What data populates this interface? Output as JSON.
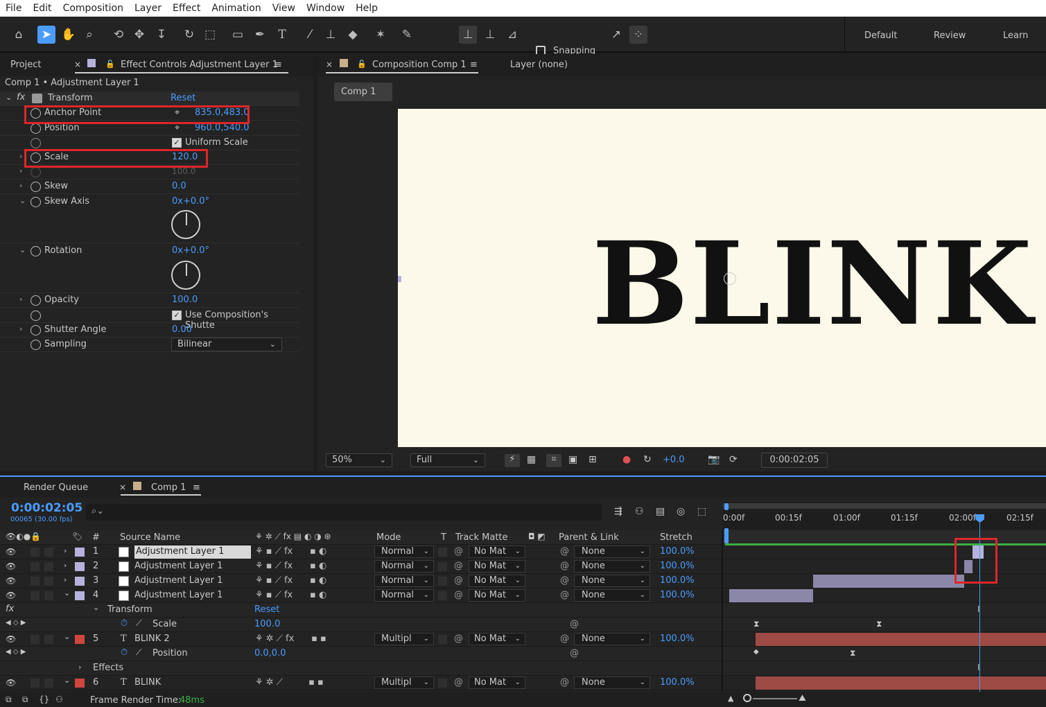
{
  "menu": [
    "File",
    "Edit",
    "Composition",
    "Layer",
    "Effect",
    "Animation",
    "View",
    "Window",
    "Help"
  ],
  "toolbar": {
    "snapping_label": "Snapping",
    "workspaces": [
      "Default",
      "Review",
      "Learn"
    ]
  },
  "project_tab": "Project",
  "effect_controls": {
    "tab_label": "Effect Controls Adjustment Layer 1",
    "breadcrumb": "Comp 1 • Adjustment Layer 1",
    "effect_name": "Transform",
    "reset_label": "Reset",
    "props": {
      "anchor_point": {
        "label": "Anchor Point",
        "value": "835.0,483.0"
      },
      "position": {
        "label": "Position",
        "value": "960.0,540.0"
      },
      "uniform_scale": {
        "label": "Uniform Scale",
        "checked": true
      },
      "scale": {
        "label": "Scale",
        "value": "120.0"
      },
      "scale_height": {
        "value": "100.0"
      },
      "skew": {
        "label": "Skew",
        "value": "0.0"
      },
      "skew_axis": {
        "label": "Skew Axis",
        "value": "0x+0.0°"
      },
      "rotation": {
        "label": "Rotation",
        "value": "0x+0.0°"
      },
      "opacity": {
        "label": "Opacity",
        "value": "100.0"
      },
      "use_comp_shutter": {
        "label": "Use Composition's Shutte",
        "checked": true
      },
      "shutter_angle": {
        "label": "Shutter Angle",
        "value": "0.00"
      },
      "sampling": {
        "label": "Sampling",
        "value": "Bilinear"
      }
    }
  },
  "composition": {
    "tab_label": "Composition Comp 1",
    "layer_tab": "Layer (none)",
    "comp_button": "Comp 1",
    "text": "BLINK",
    "zoom": "50%",
    "resolution": "Full",
    "exposure": "+0.0",
    "timecode": "0:00:02:05"
  },
  "timeline": {
    "render_queue_tab": "Render Queue",
    "comp_tab": "Comp 1",
    "current_time": "0:00:02:05",
    "frame_info": "00065 (30.00 fps)",
    "search_placeholder": "",
    "columns": {
      "num": "#",
      "source_name": "Source Name",
      "mode": "Mode",
      "t": "T",
      "track_matte": "Track Matte",
      "parent_link": "Parent & Link",
      "stretch": "Stretch"
    },
    "ruler": [
      "0:00f",
      "00:15f",
      "01:00f",
      "01:15f",
      "02:00f",
      "02:15f"
    ],
    "layers": [
      {
        "num": "1",
        "name": "Adjustment Layer 1",
        "mode": "Normal",
        "track_matte": "No Mat",
        "parent": "None",
        "stretch": "100.0%",
        "label_color": "#b6b2dc"
      },
      {
        "num": "2",
        "name": "Adjustment Layer 1",
        "mode": "Normal",
        "track_matte": "No Mat",
        "parent": "None",
        "stretch": "100.0%",
        "label_color": "#b6b2dc"
      },
      {
        "num": "3",
        "name": "Adjustment Layer 1",
        "mode": "Normal",
        "track_matte": "No Mat",
        "parent": "None",
        "stretch": "100.0%",
        "label_color": "#b6b2dc"
      },
      {
        "num": "4",
        "name": "Adjustment Layer 1",
        "mode": "Normal",
        "track_matte": "No Mat",
        "parent": "None",
        "stretch": "100.0%",
        "label_color": "#b6b2dc"
      },
      {
        "num": "5",
        "name": "BLINK 2",
        "mode": "Multipl",
        "track_matte": "No Mat",
        "parent": "None",
        "stretch": "100.0%",
        "label_color": "#d0463e"
      },
      {
        "num": "6",
        "name": "BLINK",
        "mode": "Multipl",
        "track_matte": "No Mat",
        "parent": "None",
        "stretch": "100.0%",
        "label_color": "#d0463e"
      }
    ],
    "transform_group": "Transform",
    "transform_reset": "Reset",
    "scale_label": "Scale",
    "scale_value": "100.0",
    "position_label": "Position",
    "position_value": "0.0,0.0",
    "effects_label": "Effects",
    "frame_render_label": "Frame Render Time:",
    "frame_render_value": "48ms"
  }
}
